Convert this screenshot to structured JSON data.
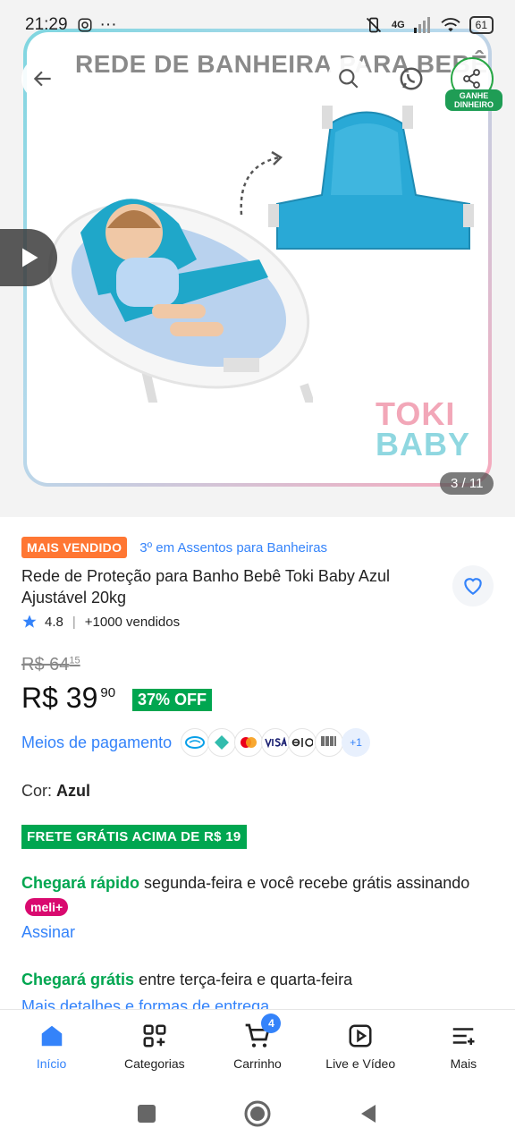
{
  "status_bar": {
    "time": "21:29",
    "network": "4G",
    "battery": "61"
  },
  "gallery": {
    "image_title": "REDE DE BANHEIRA PARA BEBÊ",
    "brand_logo_line1": "TOKI",
    "brand_logo_line2": "BABY",
    "counter": "3 / 11",
    "earn_badge": "GANHE DINHEIRO"
  },
  "product": {
    "badge": "MAIS VENDIDO",
    "rank": "3º em Assentos para Banheiras",
    "title": "Rede de Proteção para Banho Bebê Toki Baby Azul Ajustável 20kg",
    "rating": "4.8",
    "sold": "+1000 vendidos",
    "old_price": "R$ 64",
    "old_price_cents": "15",
    "price": "R$ 39",
    "price_cents": "90",
    "discount": "37% OFF",
    "payment_link": "Meios de pagamento",
    "payment_icons": [
      "mercado-pago-icon",
      "pix-icon",
      "mastercard-icon",
      "visa-icon",
      "elo-icon",
      "boleto-icon"
    ],
    "payment_more": "+1",
    "color_label": "Cor:",
    "color_value": "Azul",
    "free_shipping": "FRETE GRÁTIS ACIMA DE R$ 19",
    "delivery_fast_label": "Chegará rápido",
    "delivery_fast_text": "segunda-feira e você recebe grátis assinando",
    "meli_badge": "meli+",
    "subscribe": "Assinar",
    "delivery_free_label": "Chegará grátis",
    "delivery_free_text": "entre terça-feira e quarta-feira",
    "details_link": "Mais detalhes e formas de entrega"
  },
  "bottom_nav": {
    "items": [
      {
        "label": "Início",
        "icon": "home-icon",
        "active": true
      },
      {
        "label": "Categorias",
        "icon": "categories-icon"
      },
      {
        "label": "Carrinho",
        "icon": "cart-icon",
        "count": "4"
      },
      {
        "label": "Live e Vídeo",
        "icon": "play-icon"
      },
      {
        "label": "Mais",
        "icon": "menu-icon"
      }
    ]
  },
  "colors": {
    "accent_blue": "#3483fa",
    "green": "#00a650",
    "orange_badge": "#ff7733",
    "meli_pink": "#d90a6f"
  }
}
